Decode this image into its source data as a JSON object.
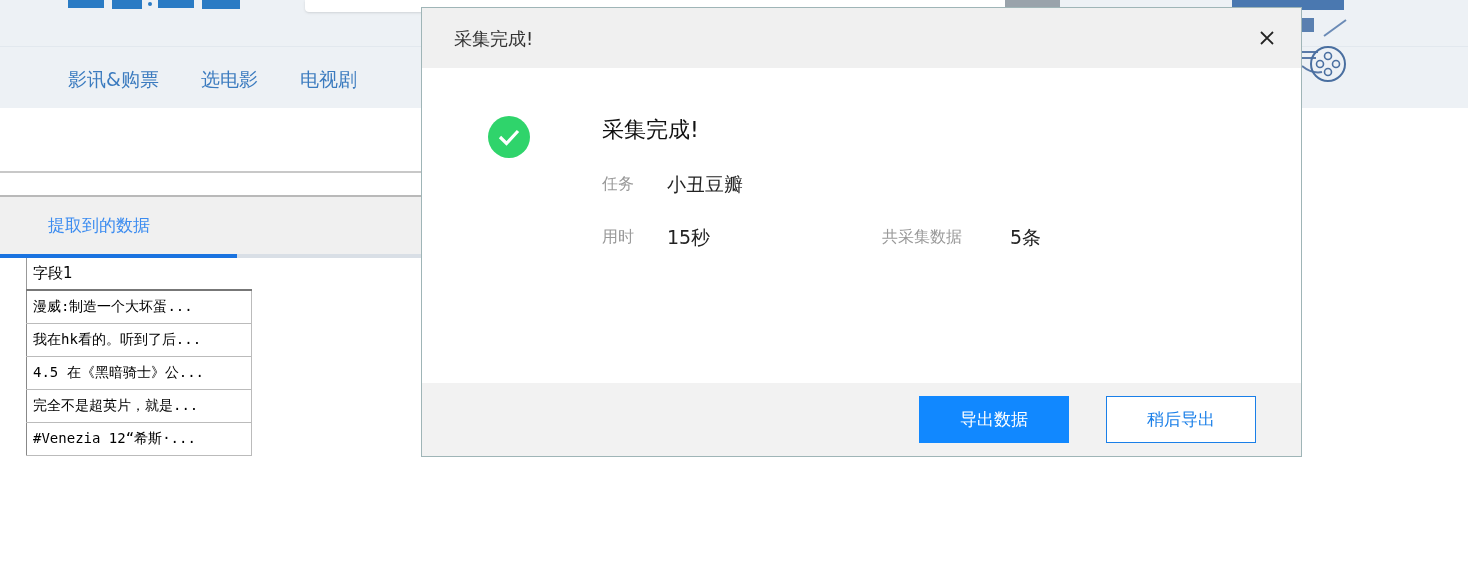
{
  "nav": [
    {
      "label": "影讯&购票"
    },
    {
      "label": "选电影"
    },
    {
      "label": "电视剧"
    }
  ],
  "tabs": [
    {
      "label": "提取到的数据",
      "selected": true
    }
  ],
  "table": {
    "columns": [
      "字段1"
    ],
    "rows": [
      [
        "漫威:制造一个大坏蛋..."
      ],
      [
        "我在hk看的。听到了后..."
      ],
      [
        "4.5 在《黑暗骑士》公..."
      ],
      [
        "完全不是超英片，就是..."
      ],
      [
        "#Venezia 12“希斯·..."
      ]
    ]
  },
  "dialog": {
    "title": "采集完成!",
    "heading": "采集完成!",
    "fields": [
      {
        "label": "任务",
        "value": "小丑豆瓣"
      },
      {
        "label": "用时",
        "value": "15秒"
      },
      {
        "label": "共采集数据",
        "value": "5条"
      }
    ],
    "buttons": [
      {
        "label": "导出数据",
        "kind": "primary"
      },
      {
        "label": "稍后导出",
        "kind": "secondary"
      }
    ]
  }
}
